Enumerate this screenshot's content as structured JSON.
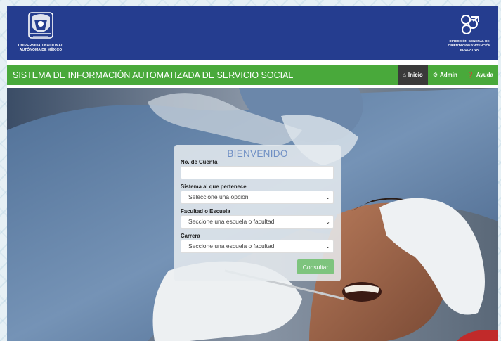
{
  "header": {
    "left_org_name_line1": "UNIVERSIDAD NACIONAL",
    "left_org_name_line2": "AUTÓNOMA DE MÉXICO",
    "right_org_name_line1": "DIRECCIÓN GENERAL DE",
    "right_org_name_line2": "ORIENTACIÓN Y ATENCIÓN",
    "right_org_name_line3": "EDUCATIVA"
  },
  "navbar": {
    "title": "SISTEMA DE INFORMACIÓN AUTOMATIZADA DE SERVICIO SOCIAL",
    "links": [
      {
        "label": "Inicio",
        "icon": "home-icon"
      },
      {
        "label": "Admin",
        "icon": "gear-icon"
      },
      {
        "label": "Ayuda",
        "icon": "question-icon"
      }
    ]
  },
  "login": {
    "title": "BIENVENIDO",
    "account_label": "No. de Cuenta",
    "account_value": "",
    "system_label": "Sistema al que pertenece",
    "system_value": "Seleccione una opcion",
    "school_label": "Facultad o Escuela",
    "school_value": "Seccione una escuela o facultad",
    "career_label": "Carrera",
    "career_value": "Seccione una escuela o facultad",
    "submit_label": "Consultar"
  },
  "colors": {
    "header_bg": "#253d8f",
    "navbar_bg": "#49a93b",
    "active_nav_bg": "#3a3a3a",
    "title_color": "#6f8fc4",
    "button_bg": "#7ec47e"
  }
}
